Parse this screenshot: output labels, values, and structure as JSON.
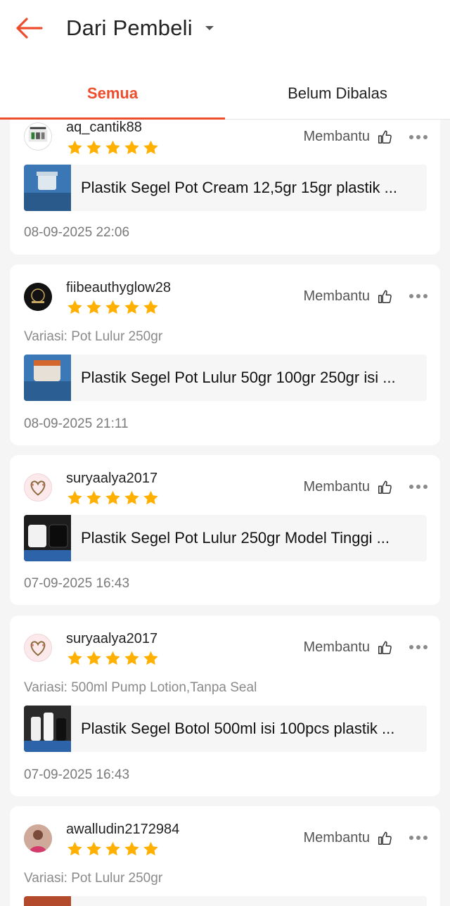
{
  "header": {
    "title": "Dari Pembeli"
  },
  "tabs": [
    {
      "label": "Semua",
      "active": true
    },
    {
      "label": "Belum Dibalas",
      "active": false
    }
  ],
  "helpful_label": "Membantu",
  "colors": {
    "accent": "#ee4d2d",
    "star": "#ffb000"
  },
  "reviews": [
    {
      "username": "aq_cantik88",
      "rating": 5,
      "variation": "",
      "product": "Plastik Segel Pot Cream 12,5gr 15gr plastik ...",
      "date": "08-09-2025 22:06"
    },
    {
      "username": "fiibeauthyglow28",
      "rating": 5,
      "variation": "Variasi: Pot Lulur 250gr",
      "product": "Plastik Segel Pot Lulur 50gr 100gr 250gr isi ...",
      "date": "08-09-2025 21:11"
    },
    {
      "username": "suryaalya2017",
      "rating": 5,
      "variation": "",
      "product": "Plastik Segel Pot Lulur 250gr Model Tinggi ...",
      "date": "07-09-2025 16:43"
    },
    {
      "username": "suryaalya2017",
      "rating": 5,
      "variation": "Variasi: 500ml Pump Lotion,Tanpa Seal",
      "product": "Plastik Segel Botol 500ml isi 100pcs plastik ...",
      "date": "07-09-2025 16:43"
    },
    {
      "username": "awalludin2172984",
      "rating": 5,
      "variation": "Variasi: Pot Lulur 250gr",
      "product": "",
      "date": ""
    }
  ]
}
